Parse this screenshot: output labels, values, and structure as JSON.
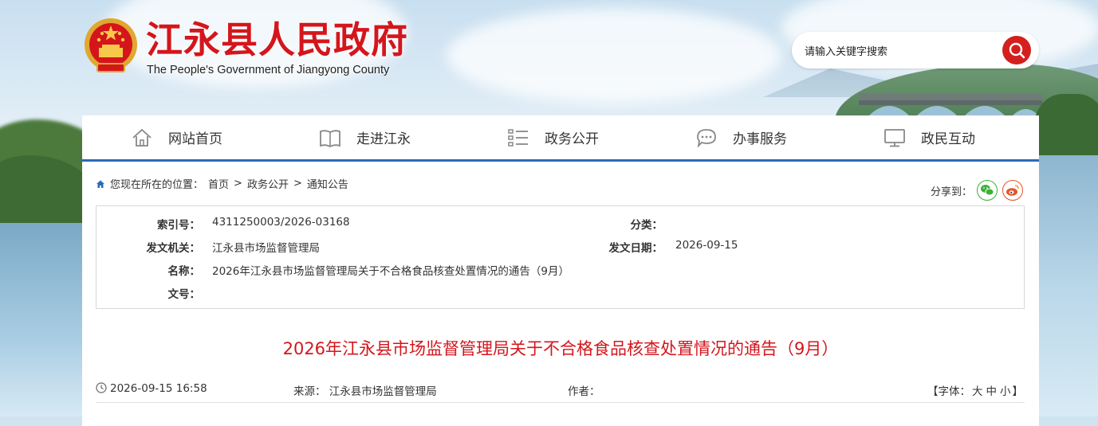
{
  "header": {
    "title": "江永县人民政府",
    "subtitle": "The People's Government of Jiangyong County",
    "search_placeholder": "请输入关键字搜索"
  },
  "nav": [
    {
      "label": "网站首页",
      "icon": "home-icon"
    },
    {
      "label": "走进江永",
      "icon": "book-icon"
    },
    {
      "label": "政务公开",
      "icon": "list-icon"
    },
    {
      "label": "办事服务",
      "icon": "chat-icon"
    },
    {
      "label": "政民互动",
      "icon": "monitor-icon"
    }
  ],
  "breadcrumb": {
    "prefix": "您现在所在的位置：",
    "items": [
      "首页",
      "政务公开",
      "通知公告"
    ],
    "separator": ">"
  },
  "share": {
    "label": "分享到：",
    "targets": [
      "wechat-icon",
      "weibo-icon"
    ],
    "colors": {
      "wechat": "#3cb035",
      "weibo": "#e6522c"
    }
  },
  "meta": {
    "index_key": "索引号：",
    "index_val": "4311250003/2026-03168",
    "category_key": "分类：",
    "category_val": "",
    "issuer_key": "发文机关：",
    "issuer_val": "江永县市场监督管理局",
    "date_key": "发文日期：",
    "date_val": "2026-09-15",
    "name_key": "名称：",
    "name_val": "2026年江永县市场监督管理局关于不合格食品核查处置情况的通告（9月）",
    "docno_key": "文号：",
    "docno_val": ""
  },
  "article": {
    "title": "2026年江永县市场监督管理局关于不合格食品核查处置情况的通告（9月）",
    "datetime": "2026-09-15 16:58",
    "source_label": "来源：",
    "source": "江永县市场监督管理局",
    "author_label": "作者：",
    "author": "",
    "font_label_open": "【字体：",
    "font_large": "大",
    "font_medium": "中",
    "font_small": "小",
    "font_label_close": "】"
  },
  "colors": {
    "brand_red": "#d4161c",
    "nav_accent": "#2a6cb8",
    "search_button": "#d41f1f"
  }
}
